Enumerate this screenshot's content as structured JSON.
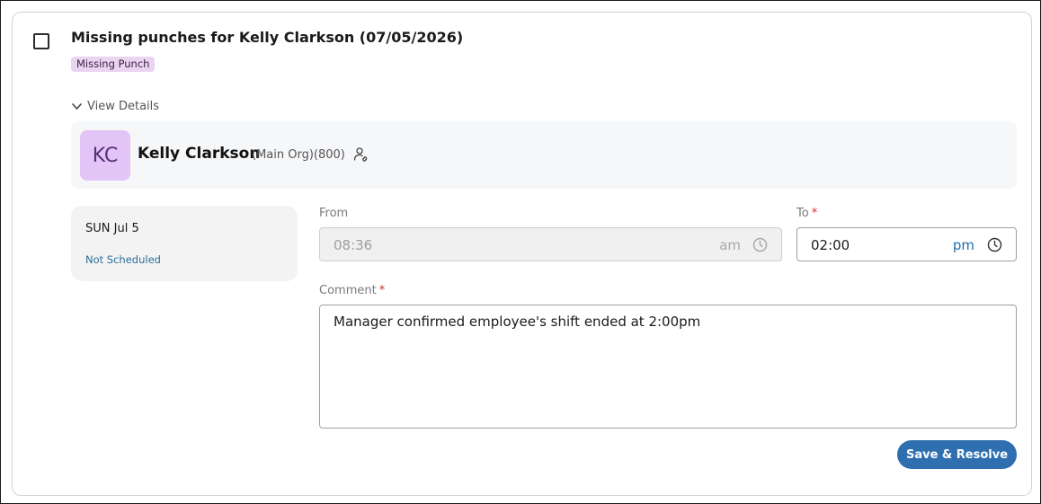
{
  "issue": {
    "title": "Missing punches for Kelly Clarkson (07/05/2026)",
    "badge": "Missing Punch",
    "details_toggle": "View Details"
  },
  "employee": {
    "initials": "KC",
    "name": "Kelly Clarkson",
    "meta": "(Main Org)(800)",
    "avatar_color": "#e3c4f7",
    "link_icon": "user-link-icon"
  },
  "day": {
    "label": "SUN Jul 5",
    "status": "Not Scheduled"
  },
  "from": {
    "label": "From",
    "time": "08:36",
    "ampm": "am"
  },
  "to": {
    "label": "To",
    "required_mark": "*",
    "time": "02:00",
    "ampm": "pm"
  },
  "comment": {
    "label": "Comment",
    "required_mark": "*",
    "value": "Manager confirmed employee's shift ended at 2:00pm"
  },
  "actions": {
    "save_label": "Save & Resolve"
  },
  "colors": {
    "accent": "#2f6fb0",
    "badge_bg": "#ead4ef",
    "required": "#d32f2f",
    "status_link": "#2a6f9b"
  }
}
